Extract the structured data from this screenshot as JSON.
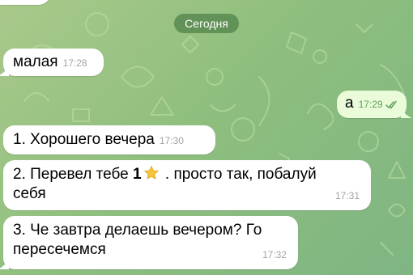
{
  "chat": {
    "date_badge": "Сегодня",
    "colors": {
      "incoming_bubble": "#ffffff",
      "outgoing_bubble": "#e9fbd9",
      "outgoing_time": "#5fa15a",
      "incoming_time": "#a3a3a3",
      "date_badge": "#4e8046"
    },
    "messages": [
      {
        "direction": "in",
        "text": "малая",
        "time": "17:28"
      },
      {
        "direction": "out",
        "text": "а",
        "time": "17:29",
        "status_icon": "double-check-read-icon"
      },
      {
        "direction": "in",
        "text": "1. Хорошего вечера",
        "time": "17:30"
      },
      {
        "direction": "in",
        "text_before": "2. Перевел тебе ",
        "amount": "1",
        "amount_icon": "star-icon",
        "text_after": " . просто так, побалуй",
        "text_line2": "себя",
        "time": "17:31"
      },
      {
        "direction": "in",
        "text": "3. Че завтра делаешь вечером? Го",
        "text_line2": "пересечемся",
        "time": "17:32"
      }
    ]
  }
}
